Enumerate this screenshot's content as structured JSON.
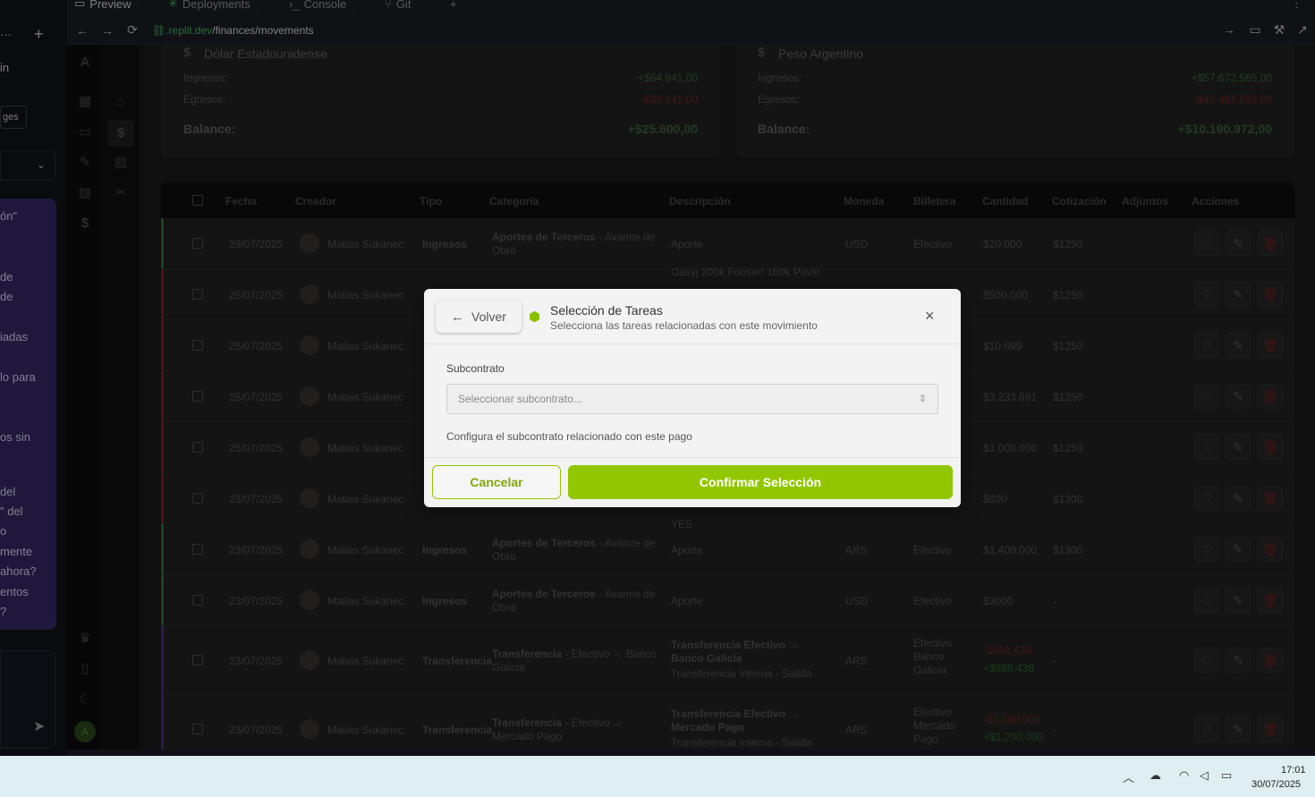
{
  "replit": {
    "tabs": [
      "Preview",
      "Deployments",
      "Console",
      "Git"
    ],
    "url_domain": ".replit.dev",
    "url_path": "/finances/movements",
    "chat_lines": [
      "in",
      "ges",
      "ón\"",
      "de",
      "de",
      "iadas",
      "lo para",
      "os sin",
      "del",
      "\" del",
      "o",
      "mente",
      "ahora?",
      "entos",
      "?"
    ]
  },
  "summary": {
    "usd": {
      "title": "Dólar Estadounidense",
      "ingresos_label": "Ingresos:",
      "ingresos": "+$64.941,00",
      "egresos_label": "Egresos:",
      "egresos": "-$39.341,00",
      "balance_label": "Balance:",
      "balance": "+$25.600,00"
    },
    "ars": {
      "title": "Peso Argentino",
      "ingresos_label": "Ingresos:",
      "ingresos": "+$57.672.565,00",
      "egresos_label": "Egresos:",
      "egresos": "-$47.481.593,00",
      "balance_label": "Balance:",
      "balance": "+$10.190.972,00"
    }
  },
  "table": {
    "headers": [
      "Fecha",
      "Creador",
      "Tipo",
      "Categoría",
      "Descripción",
      "Moneda",
      "Billetera",
      "Cantidad",
      "Cotización",
      "Adjuntos",
      "Acciones"
    ],
    "rows": [
      {
        "fecha": "29/07/2025",
        "creador": "Matias Sukanec",
        "tipo": "Ingresos",
        "cat_main": "Aportes de Terceros",
        "cat_sub": " - Avance de Obra",
        "desc": "Aporte",
        "moneda": "USD",
        "billetera": "Efectivo",
        "cantidad": "$20.000",
        "cotizacion": "$1250",
        "bar": "#2e7d32"
      },
      {
        "fecha": "25/07/2025",
        "creador": "Matias Sukanec",
        "tipo": "",
        "cat_main": "",
        "cat_sub": "",
        "desc": "Oasyj 200k Fooser! 160k Pavlo",
        "moneda": "",
        "billetera": "",
        "cantidad": "$500.000",
        "cotizacion": "$1250",
        "bar": "#8e2424"
      },
      {
        "fecha": "25/07/2025",
        "creador": "Matias Sukanec",
        "tipo": "",
        "cat_main": "",
        "cat_sub": "",
        "desc": "",
        "moneda": "",
        "billetera": "",
        "cantidad": "$10.699",
        "cotizacion": "$1250",
        "bar": "#8e2424"
      },
      {
        "fecha": "25/07/2025",
        "creador": "Matias Sukanec",
        "tipo": "",
        "cat_main": "",
        "cat_sub": "",
        "desc": "",
        "moneda": "",
        "billetera": "",
        "cantidad": "$3.233.691",
        "cotizacion": "$1250",
        "bar": "#8e2424"
      },
      {
        "fecha": "25/07/2025",
        "creador": "Matias Sukanec",
        "tipo": "",
        "cat_main": "",
        "cat_sub": "",
        "desc": "",
        "moneda": "",
        "billetera": "",
        "cantidad": "$1.000.000",
        "cotizacion": "$1250",
        "bar": "#8e2424"
      },
      {
        "fecha": "23/07/2025",
        "creador": "Matias Sukanec",
        "tipo": "",
        "cat_main": "",
        "cat_sub": "",
        "desc": "YES",
        "moneda": "",
        "billetera": "",
        "cantidad": "$800",
        "cotizacion": "$1300",
        "bar": "#8e2424"
      },
      {
        "fecha": "23/07/2025",
        "creador": "Matias Sukanec",
        "tipo": "Ingresos",
        "cat_main": "Aportes de Terceros",
        "cat_sub": " - Avance de Obra",
        "desc": "Aporte",
        "moneda": "ARS",
        "billetera": "Efectivo",
        "cantidad": "$1.400.000",
        "cotizacion": "$1300",
        "bar": "#2e7d32"
      },
      {
        "fecha": "23/07/2025",
        "creador": "Matias Sukanec",
        "tipo": "Ingresos",
        "cat_main": "Aportes de Terceros",
        "cat_sub": " - Avance de Obra",
        "desc": "Aporte",
        "moneda": "USD",
        "billetera": "Efectivo",
        "cantidad": "$3000",
        "cotizacion": "-",
        "bar": "#2e7d32"
      }
    ],
    "transfers": [
      {
        "fecha": "23/07/2025",
        "creador": "Matias Sukanec",
        "tipo": "Transferencia",
        "cat_main": "Transferencia",
        "cat_sub": " - Efectivo → Banco Galicia",
        "desc_main": "Transferencia Efectivo → Banco Galicia",
        "desc_sub": "Transferencia Interna - Salida",
        "moneda": "ARS",
        "billetera": "Efectivo\nBanco Galicia",
        "neg": "-$868.438",
        "pos": "+$868.438",
        "cotizacion": "-"
      },
      {
        "fecha": "23/07/2025",
        "creador": "Matias Sukanec",
        "tipo": "Transferencia",
        "cat_main": "Transferencia",
        "cat_sub": " - Efectivo → Mercado Pago",
        "desc_main": "Transferencia Efectivo → Mercado Pago",
        "desc_sub": "Transferencia Interna - Salida",
        "moneda": "ARS",
        "billetera": "Efectivo\nMercado Pago",
        "neg": "-$1.200.000",
        "pos": "+$1.200.000",
        "cotizacion": "-"
      }
    ]
  },
  "modal": {
    "back_label": "Volver",
    "title": "Selección de Tareas",
    "subtitle": "Selecciona las tareas relacionadas con este movimiento",
    "field_label": "Subcontrato",
    "select_placeholder": "Seleccionar subcontrato...",
    "helper": "Configura el subcontrato relacionado con este pago",
    "cancel_label": "Cancelar",
    "confirm_label": "Confirmar Selección"
  },
  "taskbar": {
    "time": "17:01",
    "date": "30/07/2025"
  },
  "colors": {
    "accent": "#92c700",
    "positive": "#4caf50",
    "negative": "#c0392b"
  }
}
